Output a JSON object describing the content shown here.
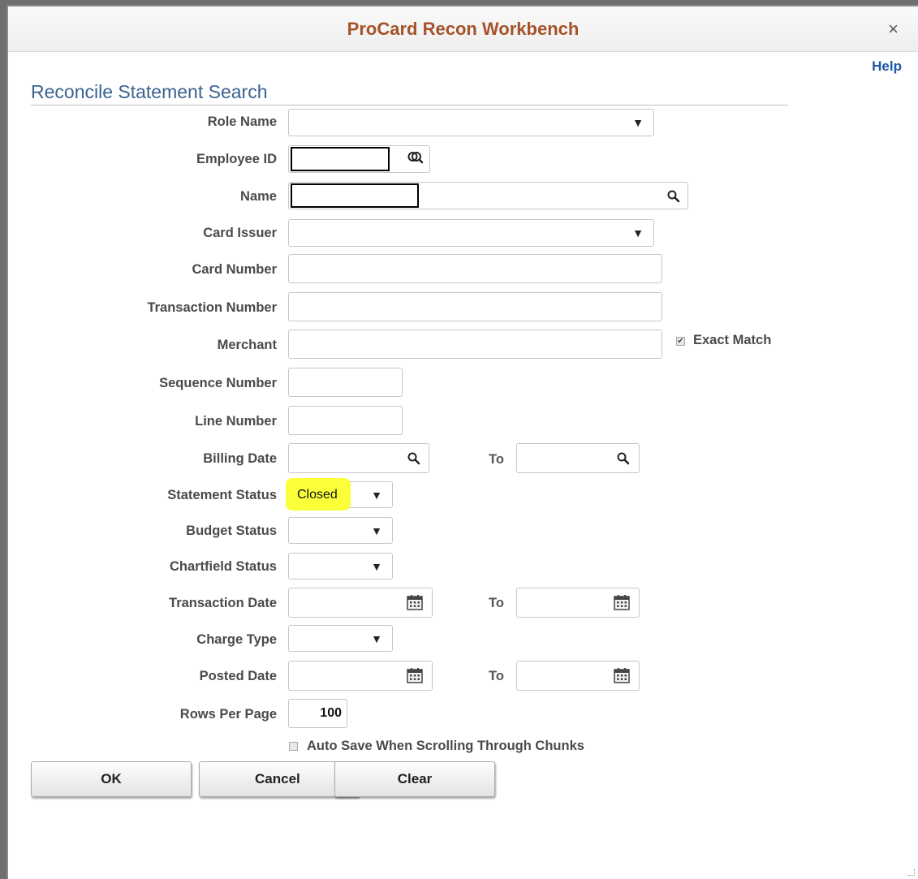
{
  "window": {
    "title": "ProCard Recon Workbench",
    "close_glyph": "×",
    "help": "Help"
  },
  "section_title": "Reconcile Statement Search",
  "labels": {
    "role_name": "Role Name",
    "employee_id": "Employee ID",
    "name": "Name",
    "card_issuer": "Card Issuer",
    "card_number": "Card Number",
    "transaction_number": "Transaction Number",
    "merchant": "Merchant",
    "sequence_number": "Sequence Number",
    "line_number": "Line Number",
    "billing_date": "Billing Date",
    "statement_status": "Statement Status",
    "budget_status": "Budget Status",
    "chartfield_status": "Chartfield Status",
    "transaction_date": "Transaction Date",
    "charge_type": "Charge Type",
    "posted_date": "Posted Date",
    "rows_per_page": "Rows Per Page",
    "to": "To"
  },
  "values": {
    "role_name": "",
    "employee_id": "",
    "name": "",
    "card_issuer": "",
    "card_number": "",
    "transaction_number": "",
    "merchant": "",
    "sequence_number": "",
    "line_number": "",
    "billing_date_from": "",
    "billing_date_to": "",
    "statement_status": "Closed",
    "budget_status": "",
    "chartfield_status": "",
    "transaction_date_from": "",
    "transaction_date_to": "",
    "charge_type": "",
    "posted_date_from": "",
    "posted_date_to": "",
    "rows_per_page": "100"
  },
  "checkboxes": {
    "exact_match": {
      "label": "Exact Match",
      "checked": true
    },
    "auto_save": {
      "label": "Auto Save When Scrolling Through Chunks",
      "checked": false
    }
  },
  "buttons": {
    "ok": "OK",
    "cancel": "Cancel",
    "clear": "Clear"
  },
  "glyphs": {
    "dropdown": "▼",
    "check": "✔"
  },
  "colors": {
    "title": "#a4532a",
    "section_title": "#3a6391",
    "help_link": "#1f56a8",
    "highlight": "#fbff3a"
  },
  "icons": [
    "search-icon",
    "lookup-icon",
    "calendar-icon",
    "dropdown-arrow-icon"
  ]
}
